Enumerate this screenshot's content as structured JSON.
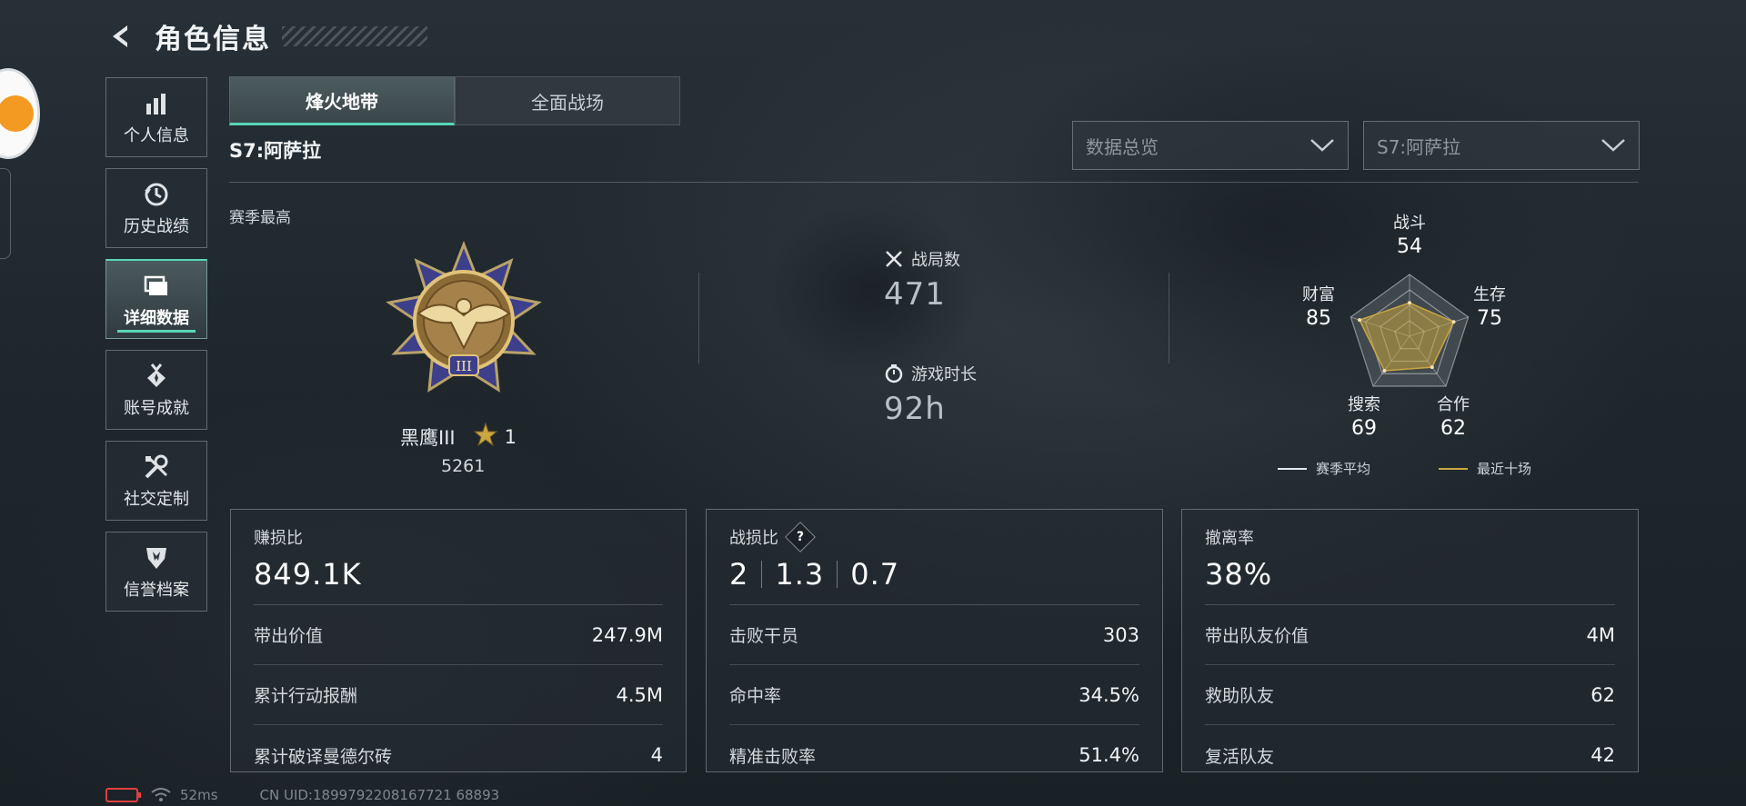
{
  "header": {
    "title": "角色信息"
  },
  "side_nav": [
    {
      "label": "个人信息",
      "icon": "bar-chart-icon",
      "active": false
    },
    {
      "label": "历史战绩",
      "icon": "history-clock-icon",
      "active": false
    },
    {
      "label": "详细数据",
      "icon": "folder-icon",
      "active": true
    },
    {
      "label": "账号成就",
      "icon": "medal-icon",
      "active": false
    },
    {
      "label": "社交定制",
      "icon": "tools-icon",
      "active": false
    },
    {
      "label": "信誉档案",
      "icon": "shield-icon",
      "active": false
    }
  ],
  "mode_tabs": [
    {
      "label": "烽火地带",
      "active": true
    },
    {
      "label": "全面战场",
      "active": false
    }
  ],
  "season": {
    "label": "S7:阿萨拉",
    "best_label": "赛季最高"
  },
  "dropdowns": {
    "data_type": "数据总览",
    "season": "S7:阿萨拉"
  },
  "rank": {
    "name": "黑鹰III",
    "stars": "1",
    "score": "5261",
    "badge_numeral": "III"
  },
  "stats": {
    "matches_label": "战局数",
    "matches_value": "471",
    "playtime_label": "游戏时长",
    "playtime_value": "92h"
  },
  "radar": {
    "axes": [
      {
        "label": "战斗",
        "value": 54
      },
      {
        "label": "生存",
        "value": 75
      },
      {
        "label": "合作",
        "value": 62
      },
      {
        "label": "搜索",
        "value": 69
      },
      {
        "label": "财富",
        "value": 85
      }
    ],
    "legend": [
      {
        "label": "赛季平均",
        "color": "#e6e9ec"
      },
      {
        "label": "最近十场",
        "color": "#c9a640"
      }
    ]
  },
  "cards": {
    "profit": {
      "title": "赚损比",
      "main": "849.1K",
      "rows": [
        {
          "label": "带出价值",
          "value": "247.9M"
        },
        {
          "label": "累计行动报酬",
          "value": "4.5M"
        },
        {
          "label": "累计破译曼德尔砖",
          "value": "4"
        }
      ]
    },
    "kd": {
      "title": "战损比",
      "main": [
        "2",
        "1.3",
        "0.7"
      ],
      "rows": [
        {
          "label": "击败干员",
          "value": "303"
        },
        {
          "label": "命中率",
          "value": "34.5%"
        },
        {
          "label": "精准击败率",
          "value": "51.4%"
        }
      ]
    },
    "extract": {
      "title": "撤离率",
      "main": "38%",
      "rows": [
        {
          "label": "带出队友价值",
          "value": "4M"
        },
        {
          "label": "救助队友",
          "value": "62"
        },
        {
          "label": "复活队友",
          "value": "42"
        }
      ]
    }
  },
  "status": {
    "ping": "52ms",
    "uid": "CN UID:1899792208167721 68893"
  },
  "colors": {
    "accent": "#58d6b8",
    "gold": "#c9a640",
    "battery": "#e04040"
  }
}
